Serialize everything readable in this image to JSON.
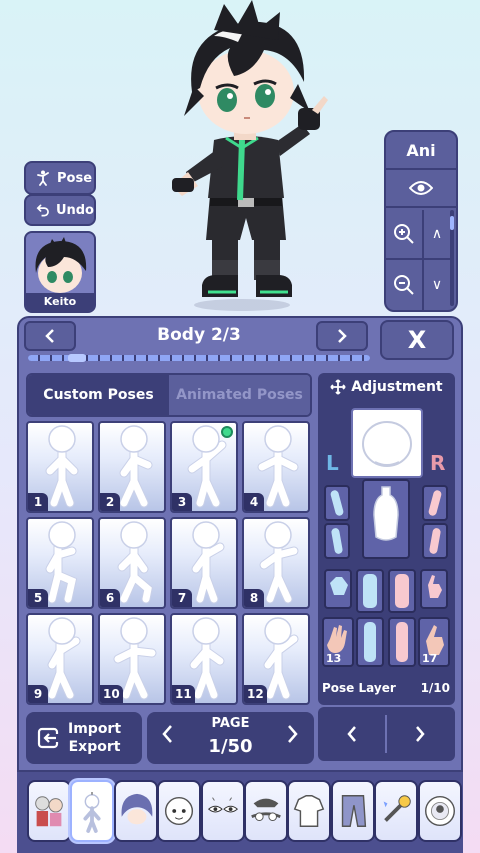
{
  "side": {
    "pose_label": "Pose",
    "undo_label": "Undo",
    "character_name": "Keito"
  },
  "ani": {
    "label": "Ani"
  },
  "panel": {
    "title": "Body 2/3",
    "close_label": "X",
    "tab_custom": "Custom Poses",
    "tab_animated": "Animated Poses",
    "poses": [
      {
        "num": "1"
      },
      {
        "num": "2"
      },
      {
        "num": "3",
        "selected": true
      },
      {
        "num": "4"
      },
      {
        "num": "5"
      },
      {
        "num": "6"
      },
      {
        "num": "7"
      },
      {
        "num": "8"
      },
      {
        "num": "9"
      },
      {
        "num": "10"
      },
      {
        "num": "11"
      },
      {
        "num": "12"
      }
    ],
    "import_label": "Import",
    "export_label": "Export",
    "page_label": "PAGE",
    "page_value": "1/50"
  },
  "adjustment": {
    "title": "Adjustment",
    "left_label": "L",
    "right_label": "R",
    "part_13": "13",
    "part_17": "17",
    "layer_label": "Pose Layer",
    "layer_value": "1/10"
  },
  "categories": [
    "presets-icon",
    "body-icon",
    "hair-icon",
    "face-icon",
    "eyes-icon",
    "accessories-icon",
    "top-icon",
    "bottom-icon",
    "props-icon",
    "profile-icon"
  ],
  "colors": {
    "panel": "#6e72b3",
    "panel_dark": "#3c3f78",
    "button": "#5b5f9c",
    "selected_dot": "#3fd98d",
    "left_color": "#6fb7e6",
    "right_color": "#e89aaa"
  }
}
